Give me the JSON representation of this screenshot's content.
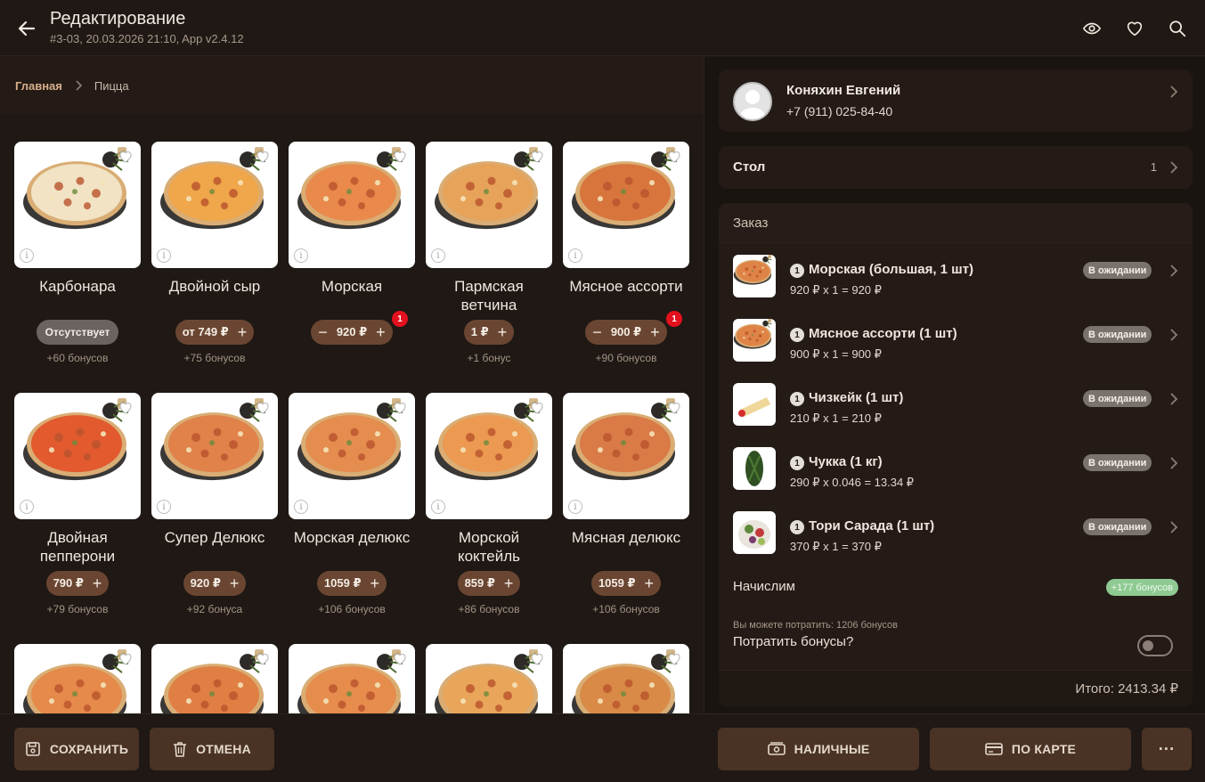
{
  "header": {
    "title": "Редактирование",
    "subtitle": "#3-03, 20.03.2026 21:10, App v2.4.12",
    "icons": [
      "eye-icon",
      "heart-icon",
      "search-icon"
    ]
  },
  "breadcrumb": {
    "home": "Главная",
    "current": "Пицца"
  },
  "products": [
    {
      "name": "Карбонара",
      "price": "Отсутствует",
      "available": false,
      "bonus": "+60 бонусов",
      "count": null,
      "sauce": "#f1e3c4"
    },
    {
      "name": "Двойной сыр",
      "price": "от 749 ₽",
      "available": true,
      "bonus": "+75 бонусов",
      "count": null,
      "sauce": "#f0a64a"
    },
    {
      "name": "Морская",
      "price": "920 ₽",
      "available": true,
      "bonus": "",
      "count": "1",
      "sauce": "#e98a4c"
    },
    {
      "name": "Пармская ветчина",
      "price": "1 ₽",
      "available": true,
      "bonus": "+1 бонус",
      "count": null,
      "sauce": "#e7a35a"
    },
    {
      "name": "Мясное ассорти",
      "price": "900 ₽",
      "available": true,
      "bonus": "+90 бонусов",
      "count": "1",
      "sauce": "#d7753c"
    },
    {
      "name": "Двойная пепперони",
      "price": "790 ₽",
      "available": true,
      "bonus": "+79 бонусов",
      "count": null,
      "sauce": "#e25a2e"
    },
    {
      "name": "Супер Делюкс",
      "price": "920 ₽",
      "available": true,
      "bonus": "+92 бонуса",
      "count": null,
      "sauce": "#e0824a"
    },
    {
      "name": "Морская делюкс",
      "price": "1059 ₽",
      "available": true,
      "bonus": "+106 бонусов",
      "count": null,
      "sauce": "#e48d4f"
    },
    {
      "name": "Морской коктейль",
      "price": "859 ₽",
      "available": true,
      "bonus": "+86 бонусов",
      "count": null,
      "sauce": "#ec9951"
    },
    {
      "name": "Мясная делюкс",
      "price": "1059 ₽",
      "available": true,
      "bonus": "+106 бонусов",
      "count": null,
      "sauce": "#d97a47"
    },
    {
      "name": "",
      "price": "",
      "available": true,
      "bonus": "",
      "count": null,
      "sauce": "#e58a4a"
    },
    {
      "name": "",
      "price": "",
      "available": true,
      "bonus": "",
      "count": null,
      "sauce": "#e07f44"
    },
    {
      "name": "",
      "price": "",
      "available": true,
      "bonus": "",
      "count": null,
      "sauce": "#e68d4d"
    },
    {
      "name": "",
      "price": "",
      "available": true,
      "bonus": "",
      "count": null,
      "sauce": "#e9a559"
    },
    {
      "name": "",
      "price": "",
      "available": true,
      "bonus": "",
      "count": null,
      "sauce": "#d98a46"
    }
  ],
  "client": {
    "name": "Коняхин Евгений",
    "phone": "+7 (911) 025-84-40"
  },
  "table": {
    "label": "Стол",
    "value": "1"
  },
  "order": {
    "title": "Заказ",
    "items": [
      {
        "qty": "1",
        "name": "Морская (большая, 1 шт)",
        "calc": "920 ₽ x 1 = 920 ₽",
        "status": "В ожидании",
        "thumb": "pizza"
      },
      {
        "qty": "1",
        "name": "Мясное ассорти (1 шт)",
        "calc": "900 ₽ x 1 = 900 ₽",
        "status": "В ожидании",
        "thumb": "pizza"
      },
      {
        "qty": "1",
        "name": "Чизкейк (1 шт)",
        "calc": "210 ₽ x 1 = 210 ₽",
        "status": "В ожидании",
        "thumb": "cheesecake"
      },
      {
        "qty": "1",
        "name": "Чукка (1 кг)",
        "calc": "290 ₽ x 0.046 = 13.34 ₽",
        "status": "В ожидании",
        "thumb": "salad-green"
      },
      {
        "qty": "1",
        "name": "Тори Сарада (1 шт)",
        "calc": "370 ₽ x 1 = 370 ₽",
        "status": "В ожидании",
        "thumb": "salad"
      }
    ],
    "accrue_label": "Начислим",
    "accrue_value": "+177 бонусов",
    "can_spend": "Вы можете потратить: 1206 бонусов",
    "spend_question": "Потратить бонусы?",
    "spend_toggle_on": false,
    "total": "Итого: 2413.34 ₽"
  },
  "actions": {
    "save": "СОХРАНИТЬ",
    "cancel": "ОТМЕНА",
    "cash": "НАЛИЧНЫЕ",
    "card": "ПО КАРТЕ",
    "more": "···"
  },
  "colors": {
    "background": "#1f1814",
    "button": "#4a3325",
    "price_pill": "#6a4632",
    "accent_text": "#d7b08a",
    "badge": "#e3101d",
    "bonus_tag": "#8fca93"
  }
}
